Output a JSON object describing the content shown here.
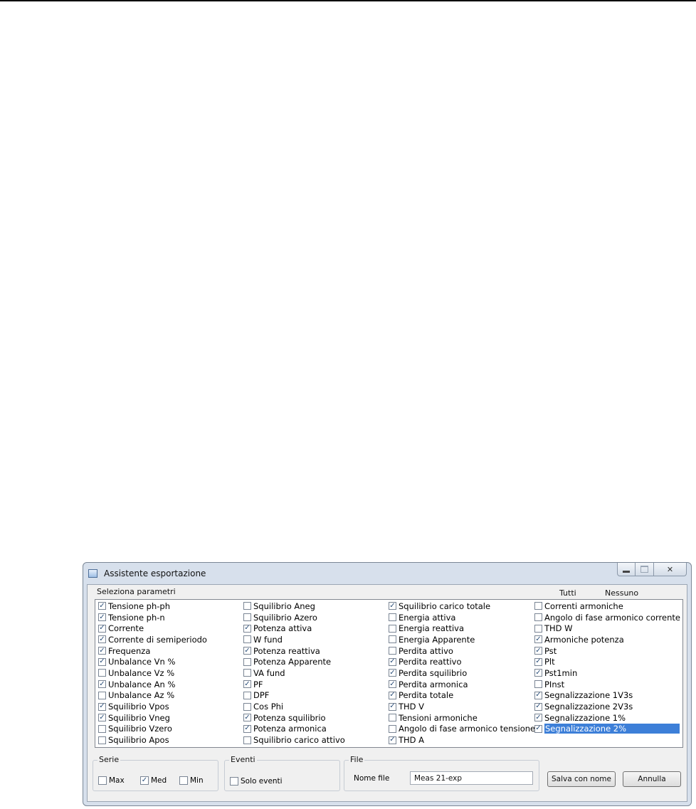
{
  "window": {
    "title": "Assistente esportazione",
    "controls": {
      "minimize": "minimize-icon",
      "maximize": "maximize-icon",
      "close": "close-icon",
      "close_glyph": "✕"
    }
  },
  "params": {
    "title": "Seleziona parametri",
    "all_label": "Tutti",
    "none_label": "Nessuno",
    "check_glyph": "✓",
    "columns": [
      [
        {
          "label": "Tensione ph-ph",
          "checked": true
        },
        {
          "label": "Tensione ph-n",
          "checked": true
        },
        {
          "label": "Corrente",
          "checked": true
        },
        {
          "label": "Corrente di semiperiodo",
          "checked": true
        },
        {
          "label": "Frequenza",
          "checked": true
        },
        {
          "label": "Unbalance Vn %",
          "checked": true
        },
        {
          "label": "Unbalance Vz %",
          "checked": false
        },
        {
          "label": "Unbalance An %",
          "checked": true
        },
        {
          "label": "Unbalance Az %",
          "checked": false
        },
        {
          "label": "Squilibrio Vpos",
          "checked": true
        },
        {
          "label": "Squilibrio Vneg",
          "checked": true
        },
        {
          "label": "Squilibrio Vzero",
          "checked": false
        },
        {
          "label": "Squilibrio Apos",
          "checked": false
        }
      ],
      [
        {
          "label": "Squilibrio Aneg",
          "checked": false
        },
        {
          "label": "Squilibrio Azero",
          "checked": false
        },
        {
          "label": "Potenza attiva",
          "checked": true
        },
        {
          "label": "W fund",
          "checked": false
        },
        {
          "label": "Potenza reattiva",
          "checked": true
        },
        {
          "label": "Potenza Apparente",
          "checked": false
        },
        {
          "label": "VA fund",
          "checked": false
        },
        {
          "label": "PF",
          "checked": true
        },
        {
          "label": "DPF",
          "checked": false
        },
        {
          "label": "Cos Phi",
          "checked": false
        },
        {
          "label": "Potenza squilibrio",
          "checked": true
        },
        {
          "label": "Potenza armonica",
          "checked": true
        },
        {
          "label": "Squilibrio carico attivo",
          "checked": false
        }
      ],
      [
        {
          "label": "Squilibrio carico totale",
          "checked": true
        },
        {
          "label": "Energia attiva",
          "checked": false
        },
        {
          "label": "Energia reattiva",
          "checked": false
        },
        {
          "label": "Energia Apparente",
          "checked": false
        },
        {
          "label": "Perdita attivo",
          "checked": false
        },
        {
          "label": "Perdita reattivo",
          "checked": true
        },
        {
          "label": "Perdita squilibrio",
          "checked": true
        },
        {
          "label": "Perdita armonica",
          "checked": true
        },
        {
          "label": "Perdita totale",
          "checked": true
        },
        {
          "label": "THD V",
          "checked": true
        },
        {
          "label": "Tensioni armoniche",
          "checked": false
        },
        {
          "label": "Angolo di fase armonico tensione",
          "checked": false
        },
        {
          "label": "THD A",
          "checked": true
        }
      ],
      [
        {
          "label": "Correnti armoniche",
          "checked": false
        },
        {
          "label": "Angolo di fase armonico corrente",
          "checked": false
        },
        {
          "label": "THD W",
          "checked": false
        },
        {
          "label": "Armoniche potenza",
          "checked": true
        },
        {
          "label": "Pst",
          "checked": true
        },
        {
          "label": "Plt",
          "checked": true
        },
        {
          "label": "Pst1min",
          "checked": true
        },
        {
          "label": "PInst",
          "checked": false
        },
        {
          "label": "Segnalizzazione 1V3s",
          "checked": true
        },
        {
          "label": "Segnalizzazione 2V3s",
          "checked": true
        },
        {
          "label": "Segnalizzazione 1%",
          "checked": true
        },
        {
          "label": "Segnalizzazione 2%",
          "checked": true,
          "selected": true
        }
      ]
    ]
  },
  "serie": {
    "title": "Serie",
    "max": {
      "label": "Max",
      "checked": false
    },
    "med": {
      "label": "Med",
      "checked": true
    },
    "min": {
      "label": "Min",
      "checked": false
    }
  },
  "eventi": {
    "title": "Eventi",
    "solo_eventi": {
      "label": "Solo eventi",
      "checked": false
    }
  },
  "file": {
    "title": "File",
    "name_label": "Nome file",
    "name_value": "Meas 21-exp"
  },
  "buttons": {
    "save": "Salva con nome",
    "cancel": "Annulla"
  },
  "colors": {
    "selection": "#3d7fd8",
    "frame": "#d7e0ec"
  }
}
